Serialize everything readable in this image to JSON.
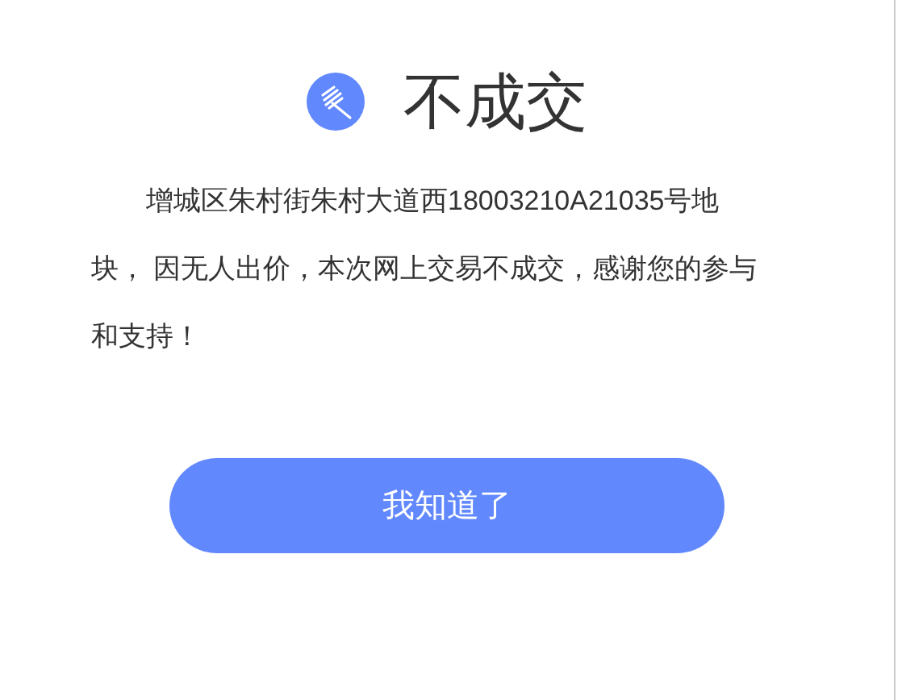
{
  "title": "不成交",
  "message": "增城区朱村街朱村大道西18003210A21035号地块， 因无人出价，本次网上交易不成交，感谢您的参与和支持！",
  "button": "我知道了"
}
